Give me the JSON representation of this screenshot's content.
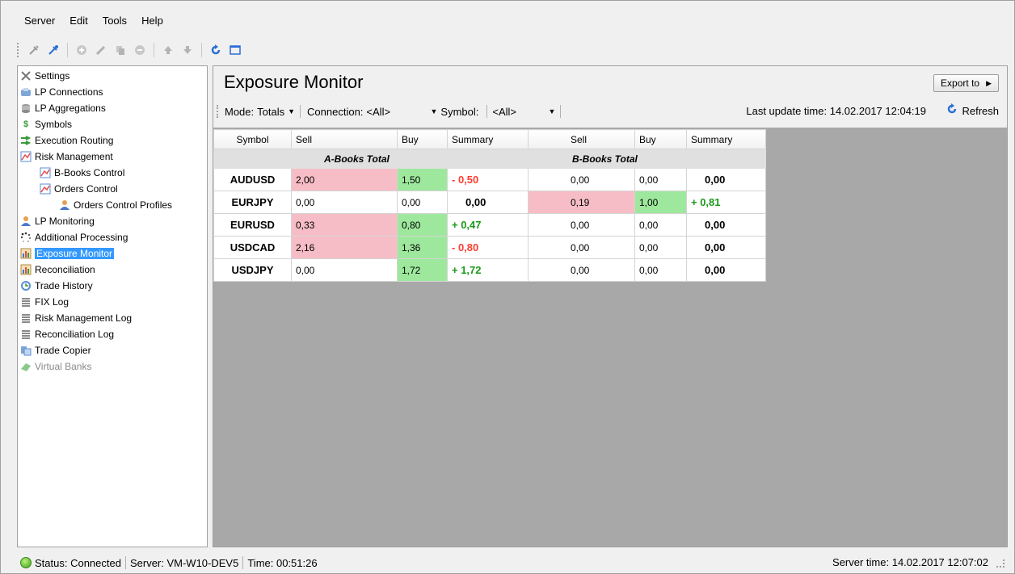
{
  "menu": [
    "Server",
    "Edit",
    "Tools",
    "Help"
  ],
  "sidebar": {
    "items": [
      {
        "label": "Settings",
        "icon": "settings-icon"
      },
      {
        "label": "LP Connections",
        "icon": "lp-connections-icon"
      },
      {
        "label": "LP Aggregations",
        "icon": "lp-aggregations-icon"
      },
      {
        "label": "Symbols",
        "icon": "symbols-icon"
      },
      {
        "label": "Execution Routing",
        "icon": "execution-routing-icon"
      },
      {
        "label": "Risk Management",
        "icon": "risk-management-icon"
      },
      {
        "label": "B-Books Control",
        "icon": "b-books-icon"
      },
      {
        "label": "Orders Control",
        "icon": "orders-control-icon"
      },
      {
        "label": "Orders Control Profiles",
        "icon": "profiles-icon"
      },
      {
        "label": "LP Monitoring",
        "icon": "lp-monitoring-icon"
      },
      {
        "label": "Additional Processing",
        "icon": "processing-icon"
      },
      {
        "label": "Exposure Monitor",
        "icon": "exposure-icon"
      },
      {
        "label": "Reconciliation",
        "icon": "reconciliation-icon"
      },
      {
        "label": "Trade History",
        "icon": "trade-history-icon"
      },
      {
        "label": "FIX Log",
        "icon": "log-icon"
      },
      {
        "label": "Risk Management Log",
        "icon": "log-icon"
      },
      {
        "label": "Reconciliation Log",
        "icon": "log-icon"
      },
      {
        "label": "Trade Copier",
        "icon": "trade-copier-icon"
      },
      {
        "label": "Virtual Banks",
        "icon": "virtual-banks-icon"
      }
    ]
  },
  "main": {
    "title": "Exposure Monitor",
    "export_label": "Export to",
    "mode_label": "Mode:",
    "mode_value": "Totals",
    "connection_label": "Connection:",
    "connection_value": "<All>",
    "symbol_label": "Symbol:",
    "symbol_value": "<All>",
    "last_update": "Last update time: 14.02.2017 12:04:19",
    "refresh_label": "Refresh"
  },
  "grid": {
    "columns": [
      "Symbol",
      "Sell",
      "Buy",
      "Summary",
      "Sell",
      "Buy",
      "Summary"
    ],
    "group_a": "A-Books Total",
    "group_b": "B-Books Total",
    "rows": [
      {
        "symbol": "AUDUSD",
        "a_sell": "2,00",
        "a_buy": "1,50",
        "a_sum": "- 0,50",
        "b_sell": "0,00",
        "b_buy": "0,00",
        "b_sum": "0,00"
      },
      {
        "symbol": "EURJPY",
        "a_sell": "0,00",
        "a_buy": "0,00",
        "a_sum": "0,00",
        "b_sell": "0,19",
        "b_buy": "1,00",
        "b_sum": "+ 0,81"
      },
      {
        "symbol": "EURUSD",
        "a_sell": "0,33",
        "a_buy": "0,80",
        "a_sum": "+ 0,47",
        "b_sell": "0,00",
        "b_buy": "0,00",
        "b_sum": "0,00"
      },
      {
        "symbol": "USDCAD",
        "a_sell": "2,16",
        "a_buy": "1,36",
        "a_sum": "- 0,80",
        "b_sell": "0,00",
        "b_buy": "0,00",
        "b_sum": "0,00"
      },
      {
        "symbol": "USDJPY",
        "a_sell": "0,00",
        "a_buy": "1,72",
        "a_sum": "+ 1,72",
        "b_sell": "0,00",
        "b_buy": "0,00",
        "b_sum": "0,00"
      }
    ]
  },
  "status": {
    "status": "Status: Connected",
    "server": "Server: VM-W10-DEV5",
    "time": "Time: 00:51:26",
    "server_time": "Server time: 14.02.2017 12:07:02"
  }
}
